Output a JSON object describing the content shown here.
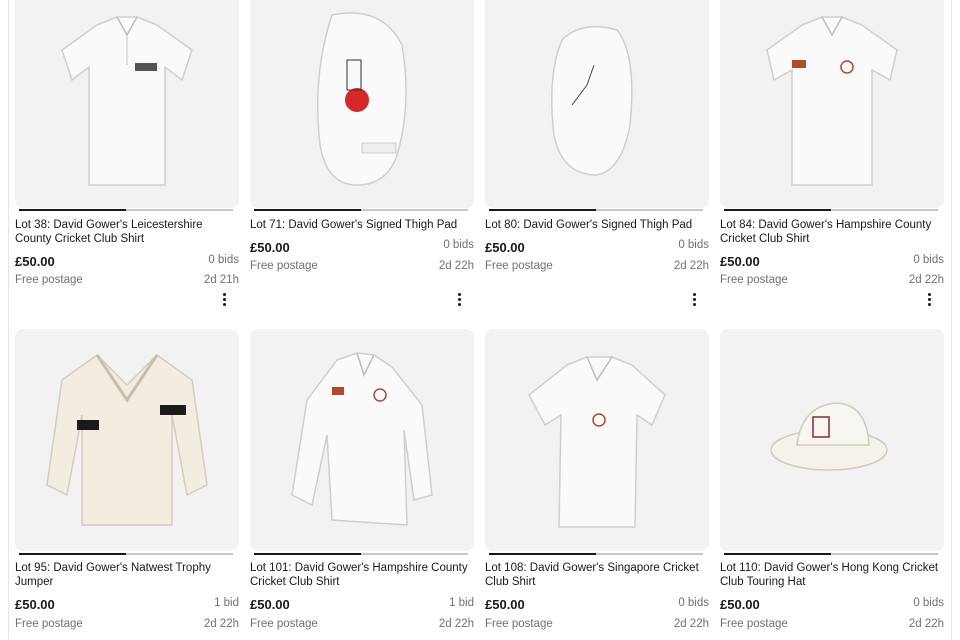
{
  "listings": [
    {
      "title": "Lot 38: David Gower's Leicestershire County Cricket Club Shirt",
      "price": "£50.00",
      "bids": "0 bids",
      "postage": "Free postage",
      "time_left": "2d 21h",
      "image": "shirt-icon",
      "progress": 0.5
    },
    {
      "title": "Lot 71: David Gower's Signed Thigh Pad",
      "price": "£50.00",
      "bids": "0 bids",
      "postage": "Free postage",
      "time_left": "2d 22h",
      "image": "thigh-pad-icon",
      "progress": 0.5
    },
    {
      "title": "Lot 80: David Gower's Signed Thigh Pad",
      "price": "£50.00",
      "bids": "0 bids",
      "postage": "Free postage",
      "time_left": "2d 22h",
      "image": "thigh-pad-icon",
      "progress": 0.5
    },
    {
      "title": "Lot 84: David Gower's Hampshire County Cricket Club Shirt",
      "price": "£50.00",
      "bids": "0 bids",
      "postage": "Free postage",
      "time_left": "2d 22h",
      "image": "shirt-icon",
      "progress": 0.5
    },
    {
      "title": "Lot 95: David Gower's Natwest Trophy Jumper",
      "price": "£50.00",
      "bids": "1 bid",
      "postage": "Free postage",
      "time_left": "2d 22h",
      "image": "jumper-icon",
      "progress": 0.5
    },
    {
      "title": "Lot 101: David Gower's Hampshire County Cricket Club Shirt",
      "price": "£50.00",
      "bids": "1 bid",
      "postage": "Free postage",
      "time_left": "2d 22h",
      "image": "long-sleeve-shirt-icon",
      "progress": 0.5
    },
    {
      "title": "Lot 108: David Gower's Singapore Cricket Club Shirt",
      "price": "£50.00",
      "bids": "0 bids",
      "postage": "Free postage",
      "time_left": "2d 22h",
      "image": "shirt-icon",
      "progress": 0.5
    },
    {
      "title": "Lot 110: David Gower's Hong Kong Cricket Club Touring Hat",
      "price": "£50.00",
      "bids": "0 bids",
      "postage": "Free postage",
      "time_left": "2d 22h",
      "image": "hat-icon",
      "progress": 0.5
    }
  ]
}
